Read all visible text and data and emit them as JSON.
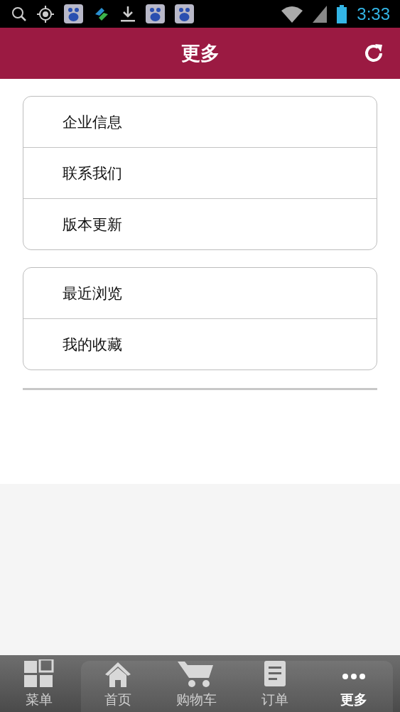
{
  "status_bar": {
    "time": "3:33"
  },
  "header": {
    "title": "更多"
  },
  "groups": [
    {
      "items": [
        {
          "label": "企业信息"
        },
        {
          "label": "联系我们"
        },
        {
          "label": "版本更新"
        }
      ]
    },
    {
      "items": [
        {
          "label": "最近浏览"
        },
        {
          "label": "我的收藏"
        }
      ]
    }
  ],
  "tab_bar": [
    {
      "label": "菜单",
      "kind": "grid",
      "selected": false
    },
    {
      "label": "首页",
      "kind": "home",
      "selected": false
    },
    {
      "label": "购物车",
      "kind": "cart",
      "selected": false
    },
    {
      "label": "订单",
      "kind": "order",
      "selected": false
    },
    {
      "label": "更多",
      "kind": "more",
      "selected": true
    }
  ]
}
